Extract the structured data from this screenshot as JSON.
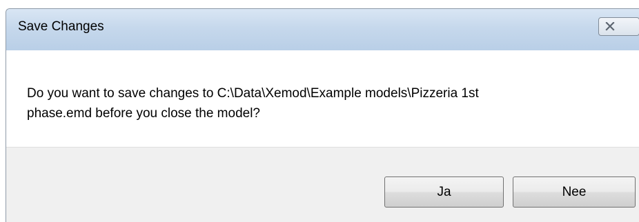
{
  "window": {
    "title": "Save Changes",
    "close_icon": "close-icon"
  },
  "message": {
    "line1": "Do you want to save changes to C:\\Data\\Xemod\\Example models\\Pizzeria 1st",
    "line2": "phase.emd before you close the model?"
  },
  "buttons": {
    "yes_label": "Ja",
    "no_label": "Nee"
  },
  "colors": {
    "titlebar": "#c6d8ec",
    "footer": "#f0f0f0"
  }
}
